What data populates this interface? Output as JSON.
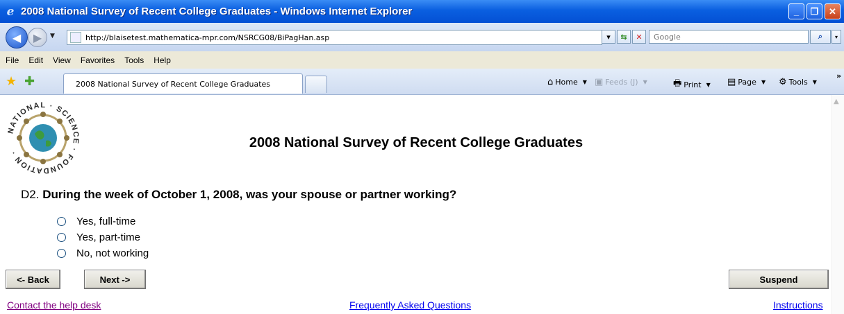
{
  "window": {
    "title": "2008 National Survey of Recent College Graduates - Windows Internet Explorer",
    "minimize": "_",
    "maximize": "❐",
    "close": "✕"
  },
  "address": {
    "url": "http://blaisetest.mathematica-mpr.com/NSRCG08/BiPagHan.asp",
    "search_placeholder": "Google"
  },
  "menu": [
    "File",
    "Edit",
    "View",
    "Favorites",
    "Tools",
    "Help"
  ],
  "tabs": {
    "active_tab": "2008 National Survey of Recent College Graduates"
  },
  "commands": {
    "home": "Home",
    "feeds": "Feeds (J)",
    "print": "Print",
    "page": "Page",
    "tools": "Tools",
    "more": "»"
  },
  "logo": {
    "text": "NATIONAL · SCIENCE · FOUNDATION"
  },
  "survey": {
    "title": "2008 National Survey of Recent College Graduates",
    "question_number": "D2.",
    "question_text": "During the week of October 1, 2008, was your spouse or partner working?",
    "options": [
      "Yes, full-time",
      "Yes, part-time",
      "No, not working"
    ]
  },
  "buttons": {
    "back": "<- Back",
    "next": "Next ->",
    "suspend": "Suspend"
  },
  "links": {
    "help_desk": "Contact the help desk",
    "faq": "Frequently Asked Questions",
    "instructions": "Instructions"
  },
  "colors": {
    "titlebar": "#0a5fe0",
    "link_visited": "#800080",
    "link": "#0000ee"
  }
}
